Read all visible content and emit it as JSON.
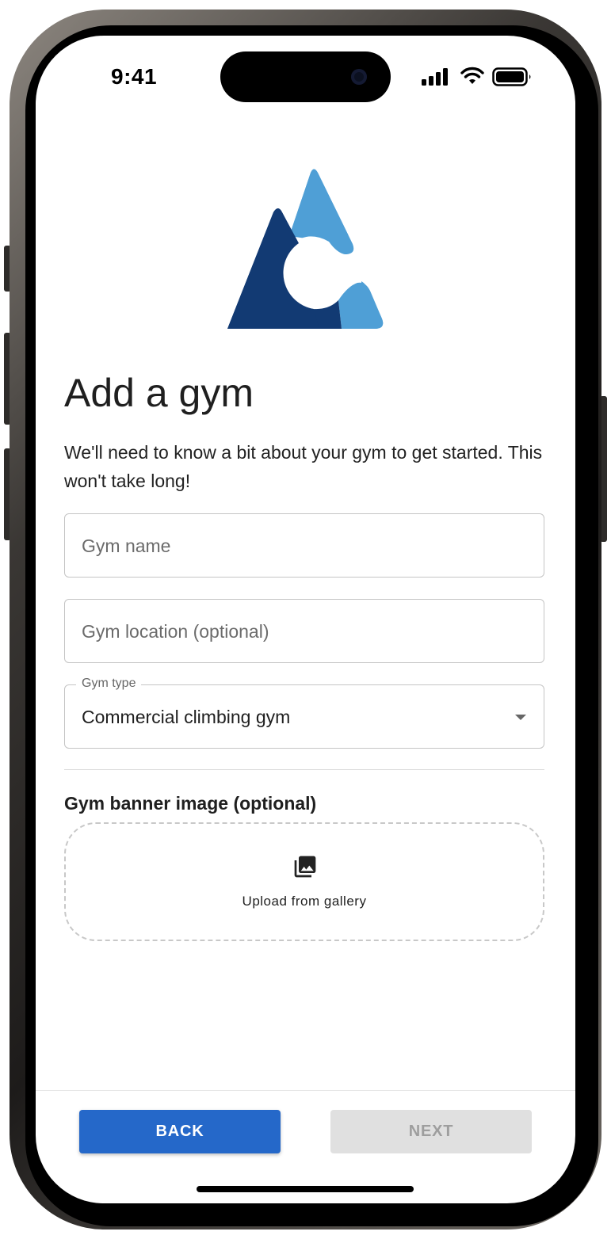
{
  "status_bar": {
    "time": "9:41"
  },
  "header": {
    "title": "Add a gym",
    "subtitle": "We'll need to know a bit about your gym to get started. This won't take long!"
  },
  "form": {
    "gym_name": {
      "placeholder": "Gym name",
      "value": ""
    },
    "gym_location": {
      "placeholder": "Gym location (optional)",
      "value": ""
    },
    "gym_type": {
      "label": "Gym type",
      "value": "Commercial climbing gym"
    },
    "banner": {
      "label": "Gym banner image (optional)",
      "upload_label": "Upload from gallery",
      "icon": "photo-library-icon"
    }
  },
  "footer": {
    "back_label": "BACK",
    "next_label": "NEXT",
    "next_enabled": false
  },
  "colors": {
    "primary": "#2568c9",
    "logo_dark": "#123a73",
    "logo_light": "#4f9fd6",
    "disabled_bg": "#e0e0e0",
    "disabled_text": "#9e9e9e"
  }
}
